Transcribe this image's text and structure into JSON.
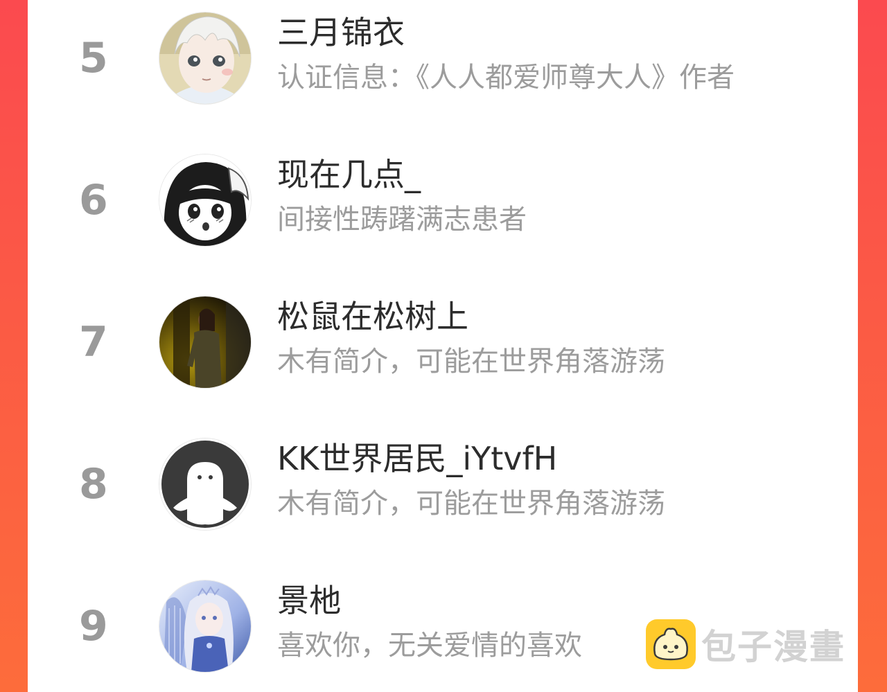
{
  "list": [
    {
      "rank": "5",
      "name": "三月锦衣",
      "bio": "认证信息：《人人都爱师尊大人》作者",
      "avatar_icon": "anime-white-hair-boy-avatar"
    },
    {
      "rank": "6",
      "name": "现在几点_",
      "bio": "间接性踌躇满志患者",
      "avatar_icon": "manga-girl-avatar"
    },
    {
      "rank": "7",
      "name": "松鼠在松树上",
      "bio": "木有简介，可能在世界角落游荡",
      "avatar_icon": "dark-photo-woman-avatar"
    },
    {
      "rank": "8",
      "name": "KK世界居民_iYtvfH",
      "bio": "木有简介，可能在世界角落游荡",
      "avatar_icon": "default-ghost-avatar"
    },
    {
      "rank": "9",
      "name": "景杝",
      "bio": "喜欢你，无关爱情的喜欢",
      "avatar_icon": "anime-princess-harp-avatar"
    }
  ],
  "watermark": {
    "text": "包子漫畫",
    "logo_icon": "bun-face-logo"
  },
  "colors": {
    "background": "#fb4a4f",
    "card": "#ffffff",
    "rank": "#9a9a9a",
    "name": "#2c2c2c",
    "bio": "#9c9c9c",
    "logo": "#ffc61a"
  }
}
